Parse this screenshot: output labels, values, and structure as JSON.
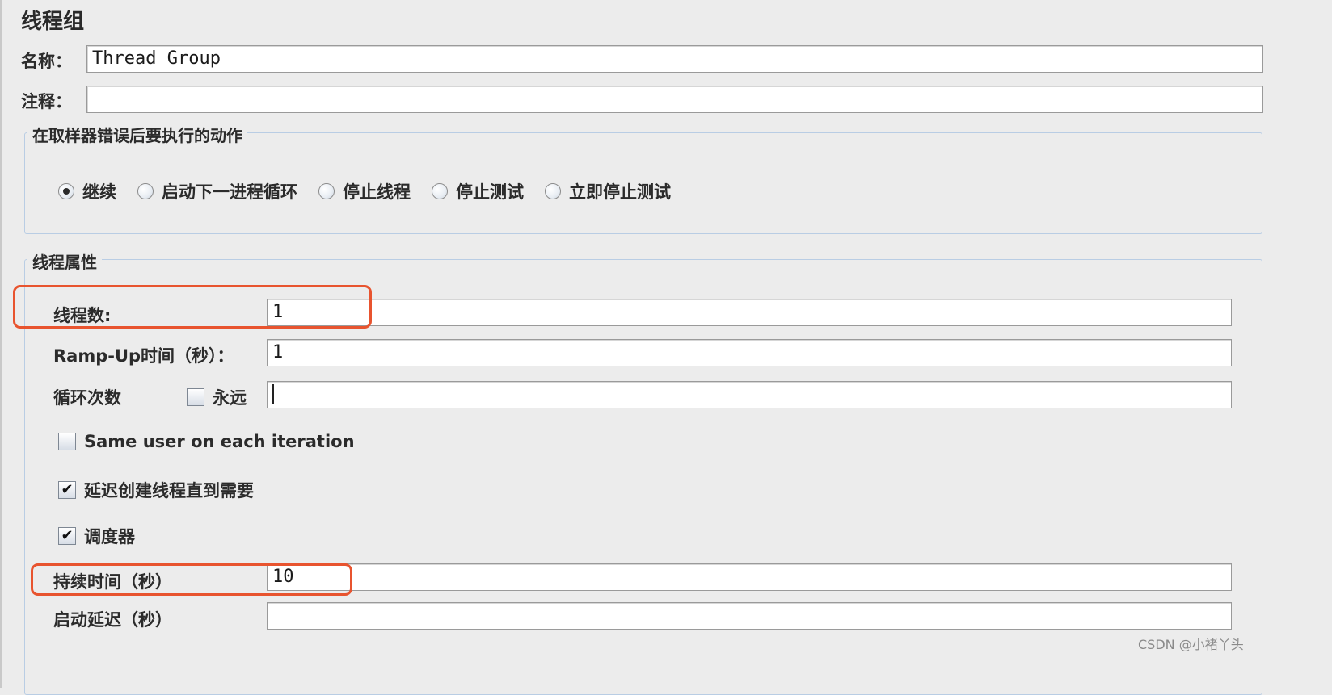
{
  "panel": {
    "title": "线程组"
  },
  "name_row": {
    "label": "名称：",
    "value": "Thread Group"
  },
  "comment_row": {
    "label": "注释：",
    "value": ""
  },
  "on_error": {
    "legend": "在取样器错误后要执行的动作",
    "options": [
      {
        "label": "继续",
        "selected": true
      },
      {
        "label": "启动下一进程循环",
        "selected": false
      },
      {
        "label": "停止线程",
        "selected": false
      },
      {
        "label": "停止测试",
        "selected": false
      },
      {
        "label": "立即停止测试",
        "selected": false
      }
    ]
  },
  "thread_props": {
    "legend": "线程属性",
    "num_threads": {
      "label": "线程数:",
      "value": "1"
    },
    "ramp_up": {
      "label": "Ramp-Up时间（秒）：",
      "value": "1"
    },
    "loop": {
      "label": "循环次数",
      "forever_label": "永远",
      "forever_checked": false,
      "value": ""
    },
    "same_user": {
      "label": "Same user on each iteration",
      "checked": false
    },
    "delay_create": {
      "label": "延迟创建线程直到需要",
      "checked": true
    },
    "scheduler": {
      "label": "调度器",
      "checked": true
    },
    "duration": {
      "label": "持续时间（秒）",
      "value": "10"
    },
    "startup_delay": {
      "label": "启动延迟（秒）",
      "value": ""
    }
  },
  "checkbox_mark": "✔",
  "watermark": "CSDN @小褚丫头",
  "colors": {
    "highlight": "#e8542f",
    "group_border": "#b9cde4",
    "background": "#ececec"
  }
}
